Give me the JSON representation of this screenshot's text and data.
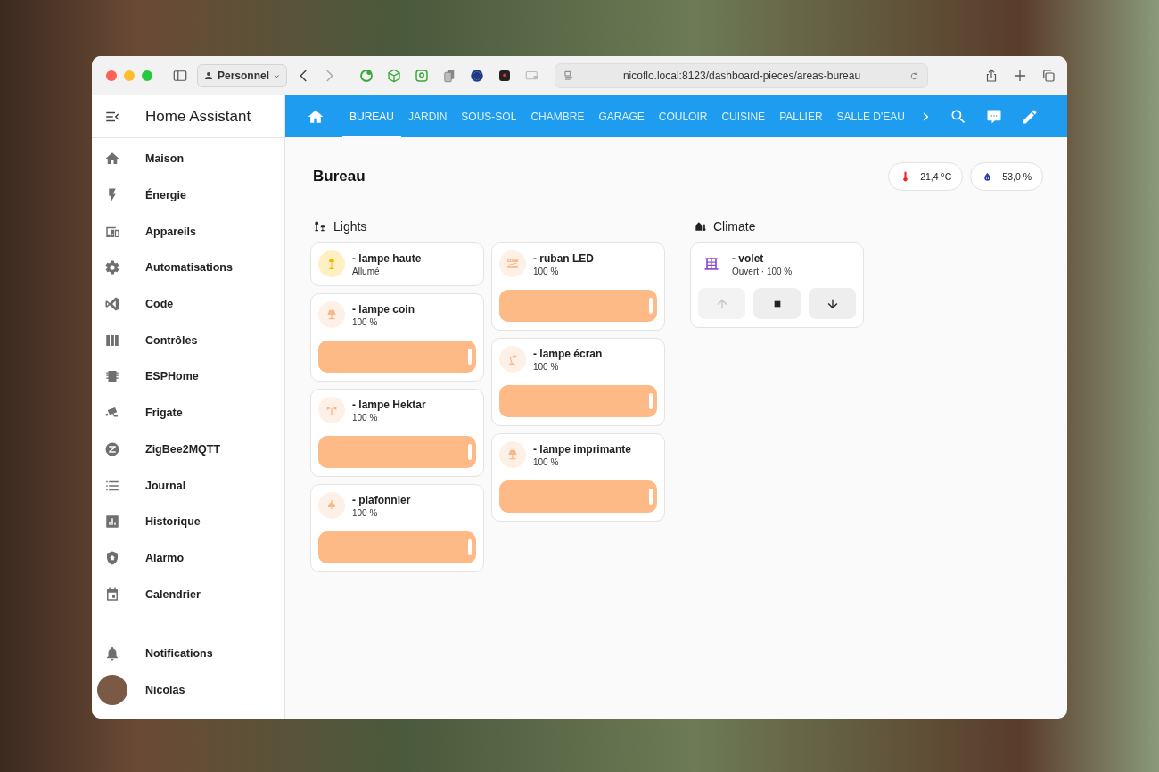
{
  "browser": {
    "profile": "Personnel",
    "url": "nicoflo.local:8123/dashboard-pieces/areas-bureau"
  },
  "sidebar": {
    "title": "Home Assistant",
    "items": [
      {
        "label": "Maison"
      },
      {
        "label": "Énergie"
      },
      {
        "label": "Appareils"
      },
      {
        "label": "Automatisations"
      },
      {
        "label": "Code"
      },
      {
        "label": "Contrôles"
      },
      {
        "label": "ESPHome"
      },
      {
        "label": "Frigate"
      },
      {
        "label": "ZigBee2MQTT"
      },
      {
        "label": "Journal"
      },
      {
        "label": "Historique"
      },
      {
        "label": "Alarmo"
      },
      {
        "label": "Calendrier"
      }
    ],
    "footer": [
      {
        "label": "Notifications"
      },
      {
        "label": "Nicolas"
      }
    ]
  },
  "tabs": [
    {
      "label": "BUREAU",
      "selected": true
    },
    {
      "label": "JARDIN",
      "selected": false
    },
    {
      "label": "SOUS-SOL",
      "selected": false
    },
    {
      "label": "CHAMBRE",
      "selected": false
    },
    {
      "label": "GARAGE",
      "selected": false
    },
    {
      "label": "COULOIR",
      "selected": false
    },
    {
      "label": "CUISINE",
      "selected": false
    },
    {
      "label": "PALLIER",
      "selected": false
    },
    {
      "label": "SALLE D'EAU",
      "selected": false
    }
  ],
  "page": {
    "title": "Bureau",
    "badges": [
      {
        "kind": "temperature",
        "value": "21,4 °C"
      },
      {
        "kind": "humidity",
        "value": "53,0 %"
      }
    ],
    "sections": [
      {
        "kind": "lights",
        "title": "Lights",
        "columns": [
          [
            {
              "kind": "light",
              "name": "- lampe haute",
              "state": "Allumé"
            },
            {
              "kind": "light",
              "name": "- lampe coin",
              "state": "100 %",
              "level": 1
            },
            {
              "kind": "light",
              "name": "- lampe Hektar",
              "state": "100 %",
              "level": 1
            },
            {
              "kind": "light",
              "name": "- plafonnier",
              "state": "100 %",
              "level": 1
            }
          ],
          [
            {
              "kind": "light",
              "name": "- ruban LED",
              "state": "100 %",
              "level": 1
            },
            {
              "kind": "light",
              "name": "- lampe écran",
              "state": "100 %",
              "level": 1
            },
            {
              "kind": "light",
              "name": "- lampe imprimante",
              "state": "100 %",
              "level": 1
            }
          ]
        ]
      },
      {
        "kind": "climate",
        "title": "Climate",
        "columns": [
          [
            {
              "kind": "cover",
              "name": "- volet",
              "state": "Ouvert · 100 %",
              "buttons": [
                {
                  "kind": "up",
                  "disabled": true
                },
                {
                  "kind": "stop",
                  "disabled": false
                },
                {
                  "kind": "down",
                  "disabled": false
                }
              ]
            }
          ]
        ]
      }
    ]
  }
}
